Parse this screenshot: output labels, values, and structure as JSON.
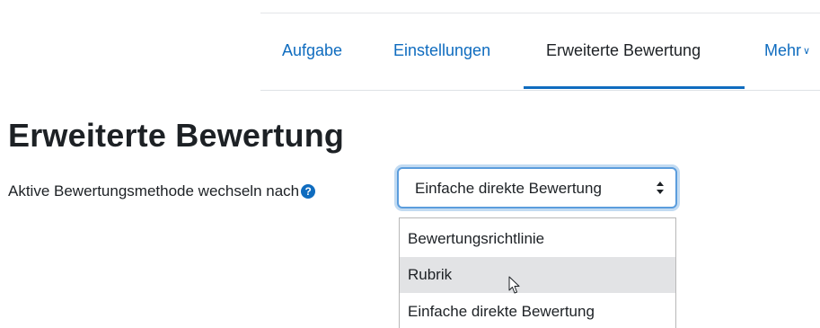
{
  "nav": {
    "tabs": [
      {
        "label": "Aufgabe",
        "active": false
      },
      {
        "label": "Einstellungen",
        "active": false
      },
      {
        "label": "Erweiterte Bewertung",
        "active": true
      },
      {
        "label": "Mehr",
        "active": false
      }
    ]
  },
  "page": {
    "title": "Erweiterte Bewertung"
  },
  "grading_method": {
    "label": "Aktive Bewertungsmethode wechseln nach",
    "help_icon": "?",
    "selected": "Einfache direkte Bewertung",
    "options": [
      "Bewertungsrichtlinie",
      "Rubrik",
      "Einfache direkte Bewertung"
    ],
    "hovered_option": "Rubrik"
  },
  "colors": {
    "link": "#0f6cbf",
    "text": "#1d2125",
    "focus_border": "#5b9ddd",
    "hover_bg": "#e2e3e5"
  },
  "icons": {
    "help": "question-circle-icon",
    "select_arrows": "sort-arrows-icon",
    "more_chevron": "chevron-down-icon",
    "cursor": "mouse-pointer-icon"
  }
}
